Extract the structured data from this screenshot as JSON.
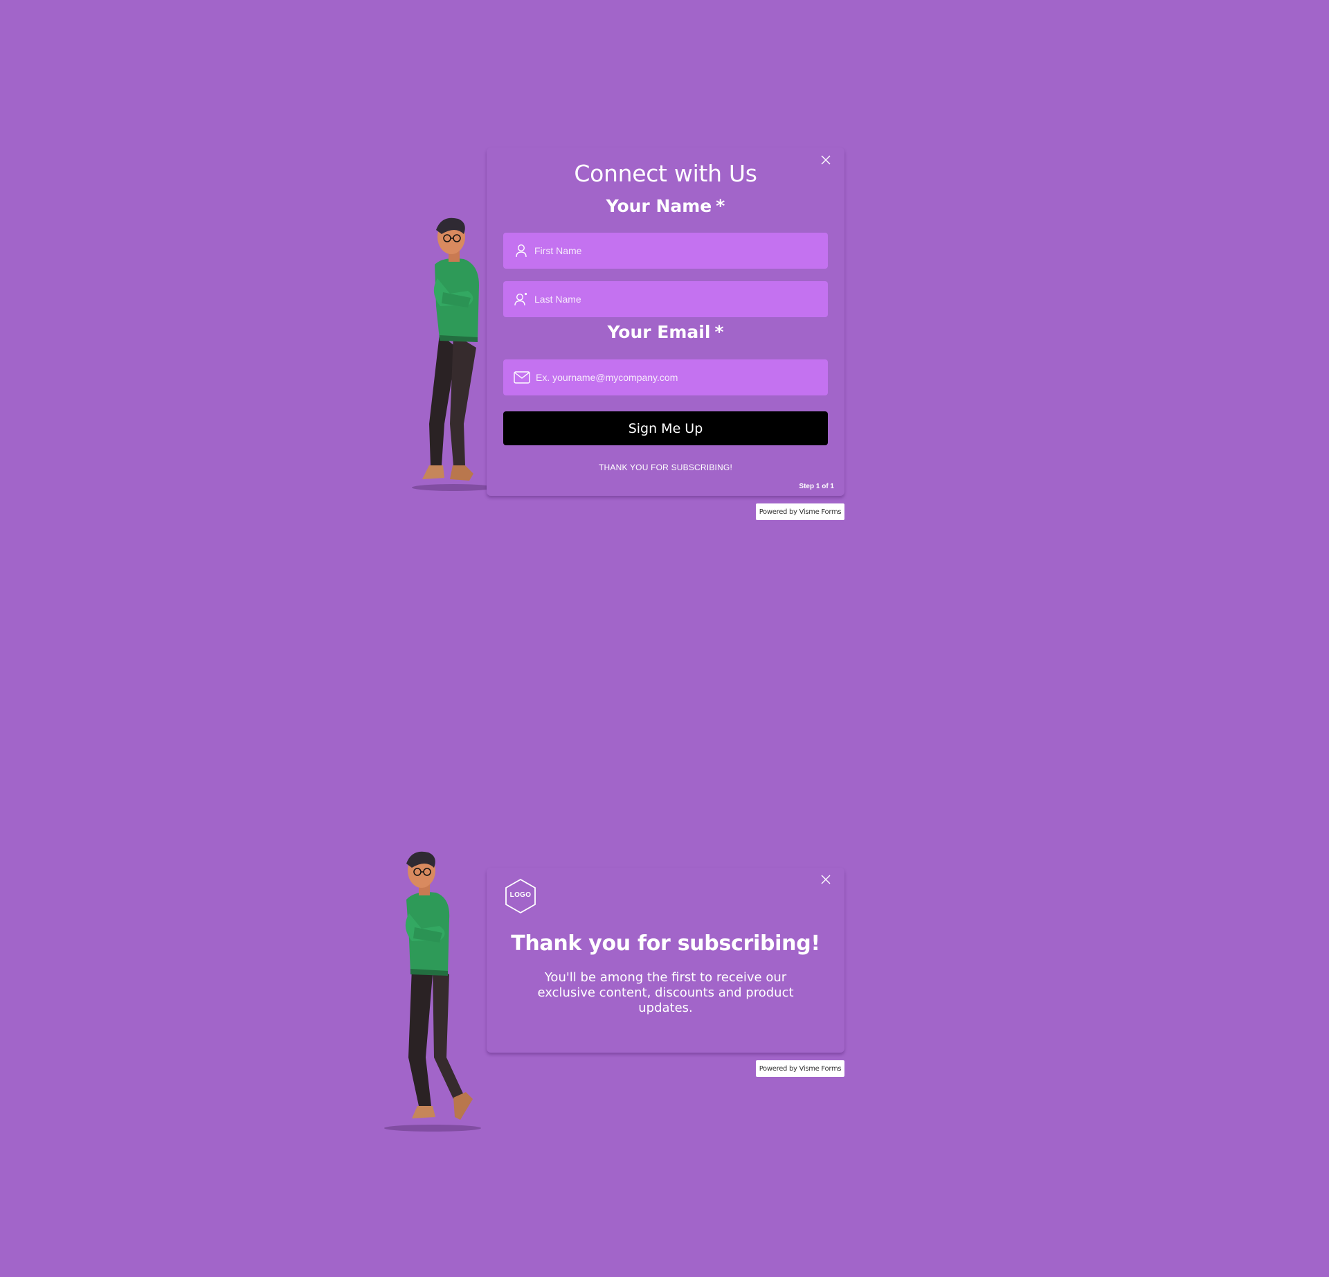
{
  "form": {
    "title": "Connect with Us",
    "name_label": "Your Name",
    "email_label": "Your Email",
    "required_marker": "*",
    "first_name": {
      "value": "",
      "placeholder": "First Name"
    },
    "last_name": {
      "value": "",
      "placeholder": "Last Name"
    },
    "email": {
      "value": "",
      "placeholder": "Ex. yourname@mycompany.com"
    },
    "submit_label": "Sign Me Up",
    "success_message": "THANK YOU FOR SUBSCRIBING!",
    "step": "Step 1 of 1",
    "powered_by": "Powered by Visme Forms"
  },
  "thanks": {
    "logo_text": "LOGO",
    "title": "Thank you for subscribing!",
    "body": "You'll be among the first to receive our exclusive content, discounts and product updates.",
    "powered_by": "Powered by Visme Forms"
  },
  "colors": {
    "background": "#a265c9",
    "field": "#c472f0",
    "button": "#000000",
    "text": "#ffffff"
  },
  "icons": {
    "close": "close-icon",
    "first_name": "user-icon",
    "last_name": "user-add-icon",
    "email": "mail-icon"
  }
}
